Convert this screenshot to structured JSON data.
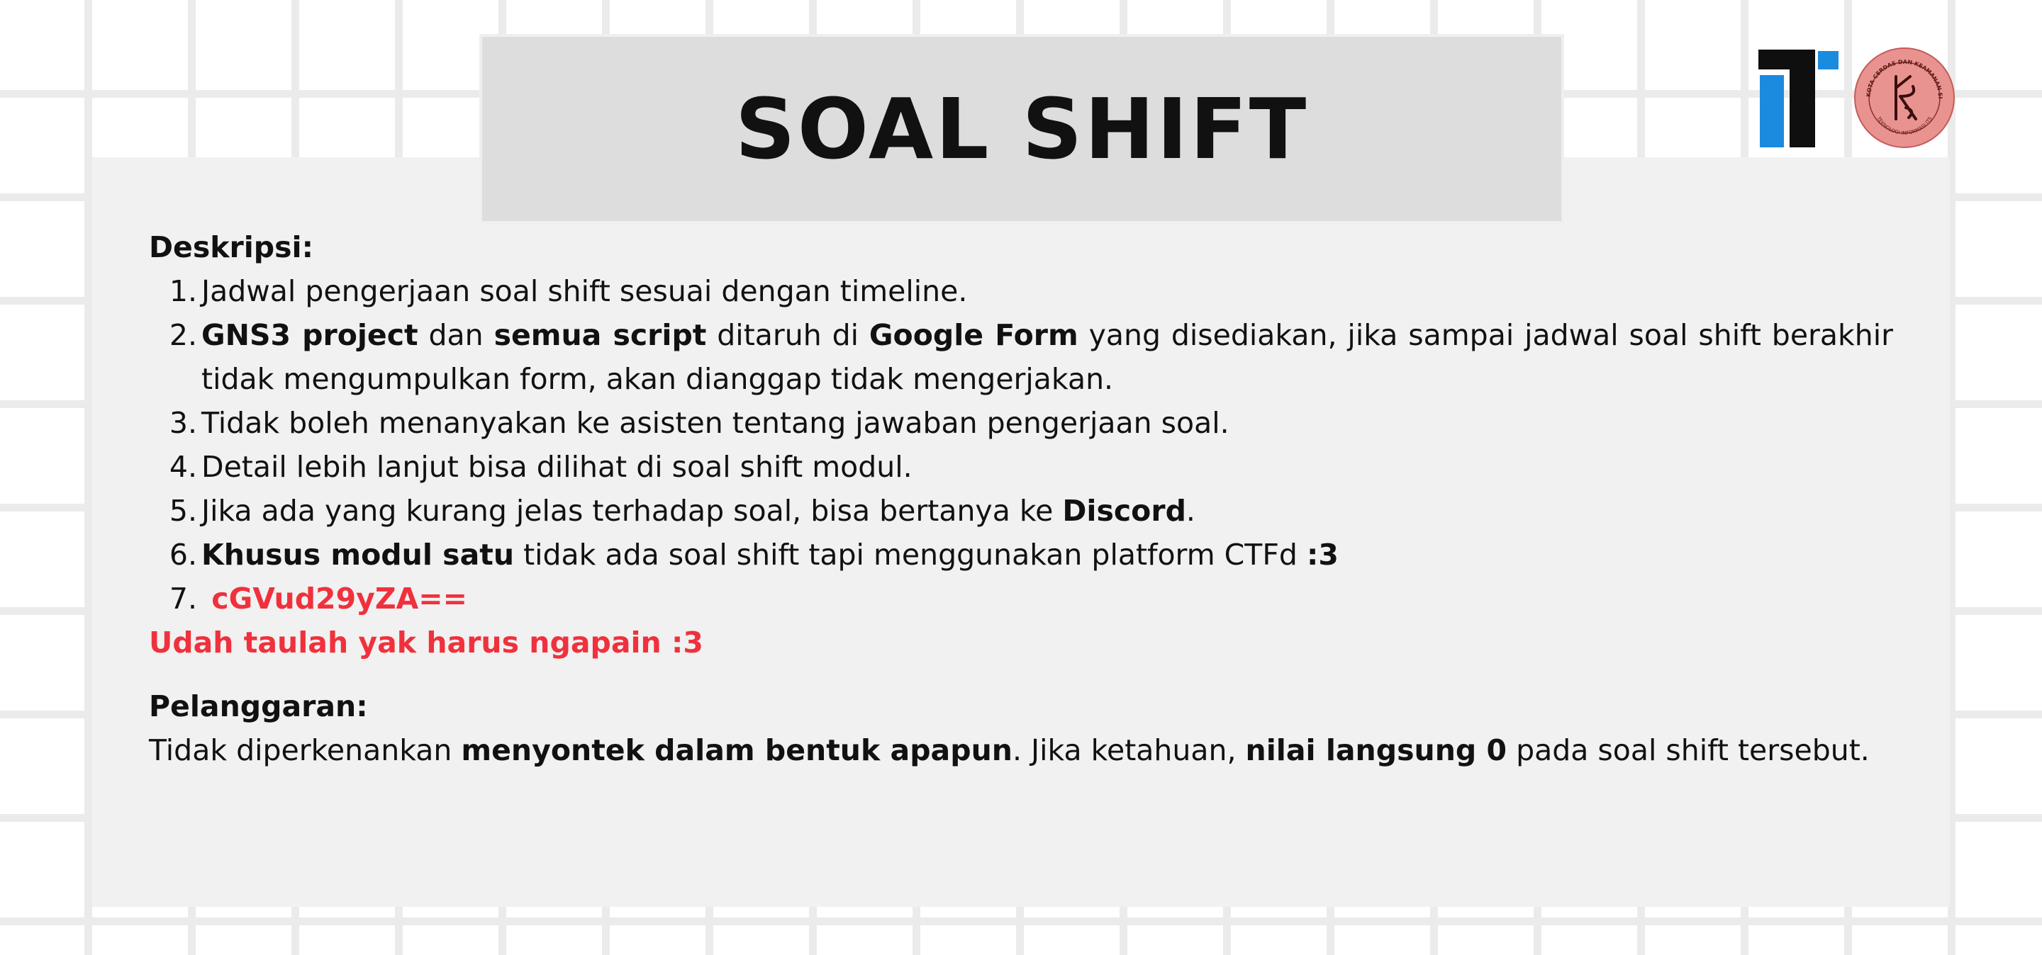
{
  "title": "SOAL SHIFT",
  "logo": {
    "it_icon": "it-logo-icon",
    "seal_icon": "lab-seal-icon",
    "seal_top_text": "LAB KOTA CERDAS DAN KEAMANAN SIBER",
    "seal_bottom_text": "TEKNOLOGI INFORMASI ITS",
    "colors": {
      "black": "#0f0f0f",
      "blue": "#1b8be0",
      "seal": "#e99390"
    }
  },
  "deskripsi": {
    "heading": "Deskripsi:",
    "items": [
      {
        "num": "1.",
        "t1": "Jadwal pengerjaan soal shift sesuai dengan timeline."
      },
      {
        "num": "2.",
        "b1": "GNS3 project",
        "t1": " dan ",
        "b2": "semua script",
        "t2": " ditaruh di ",
        "b3": "Google Form",
        "t3": " yang disediakan, jika sampai jadwal soal shift berakhir tidak mengumpulkan form, akan dianggap tidak mengerjakan."
      },
      {
        "num": "3.",
        "t1": "Tidak boleh menanyakan ke asisten tentang jawaban pengerjaan soal."
      },
      {
        "num": "4.",
        "t1": "Detail lebih lanjut bisa dilihat di soal shift modul."
      },
      {
        "num": "5.",
        "t1": "Jika ada yang kurang jelas terhadap soal, bisa bertanya ke ",
        "b1": "Discord",
        "t2": "."
      },
      {
        "num": "6.",
        "b1": "Khusus modul satu",
        "t1": " tidak ada soal shift tapi menggunakan platform CTFd ",
        "b2": ":3"
      },
      {
        "num": "7.",
        "red": " cGVud29yZA=="
      }
    ],
    "footer_red": "Udah taulah yak harus ngapain :3"
  },
  "pelanggaran": {
    "heading": "Pelanggaran:",
    "t1": "Tidak diperkenankan ",
    "b1": "menyontek dalam bentuk apapun",
    "t2": ". Jika ketahuan, ",
    "b2": "nilai langsung 0",
    "t3": " pada soal shift tersebut."
  },
  "colors": {
    "accent_red": "#f0313d",
    "panel": "#f0f1f0",
    "title_box": "#dcdddc"
  }
}
